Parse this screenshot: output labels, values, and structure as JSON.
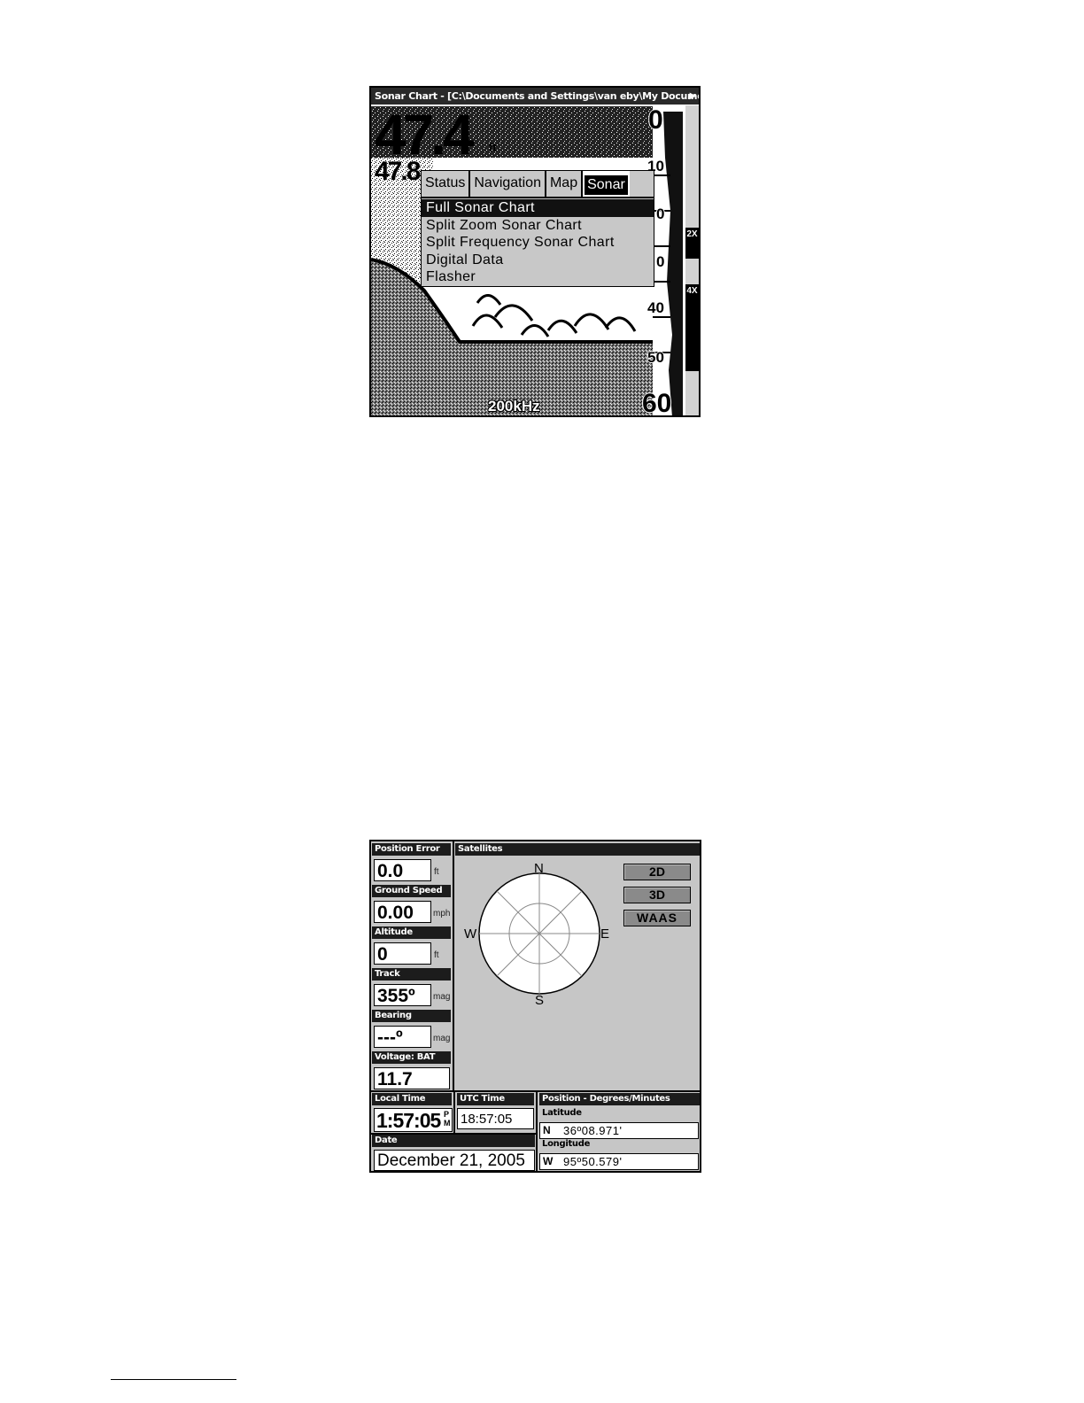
{
  "sonar": {
    "window_title": "Sonar Chart - [C:\\Documents and Settings\\van eby\\My Documents\\Emula...",
    "depth_value": "47.4",
    "depth_unit": "ft",
    "depth_secondary": "47.8",
    "frequency": "200kHz",
    "scale_labels": [
      "0",
      "10",
      "0",
      "0",
      "40",
      "50",
      "60"
    ],
    "zoom_tags": [
      "2X",
      "4X"
    ],
    "menu": {
      "tabs": [
        "Status",
        "Navigation",
        "Map",
        "Sonar"
      ],
      "selected_tab": "Sonar",
      "items": [
        "Full Sonar Chart",
        "Split Zoom Sonar Chart",
        "Split Frequency Sonar Chart",
        "Digital Data",
        "Flasher"
      ],
      "selected_item": "Full Sonar Chart"
    }
  },
  "gps": {
    "fields": [
      {
        "label": "Position Error",
        "value": "0.0",
        "unit": "ft"
      },
      {
        "label": "Ground Speed",
        "value": "0.00",
        "unit": "mph"
      },
      {
        "label": "Altitude",
        "value": "0",
        "unit": "ft"
      },
      {
        "label": "Track",
        "value": "355º",
        "unit": "mag"
      },
      {
        "label": "Bearing",
        "value": "---º",
        "unit": "mag"
      },
      {
        "label": "Voltage: BAT",
        "value": "11.7",
        "unit": ""
      }
    ],
    "satellites": {
      "title": "Satellites",
      "compass": {
        "n": "N",
        "s": "S",
        "e": "E",
        "w": "W"
      },
      "buttons": [
        "2D",
        "3D",
        "WAAS"
      ]
    },
    "local_time": {
      "label": "Local Time",
      "value": "1:57:05",
      "ampm_top": "P",
      "ampm_bottom": "M"
    },
    "utc_time": {
      "label": "UTC Time",
      "value": "18:57:05"
    },
    "date": {
      "label": "Date",
      "value": "December 21, 2005"
    },
    "position": {
      "title": "Position - Degrees/Minutes",
      "latitude_label": "Latitude",
      "latitude_hemi": "N",
      "latitude_value": "36º08.971'",
      "longitude_label": "Longitude",
      "longitude_hemi": "W",
      "longitude_value": "95º50.579'"
    }
  }
}
